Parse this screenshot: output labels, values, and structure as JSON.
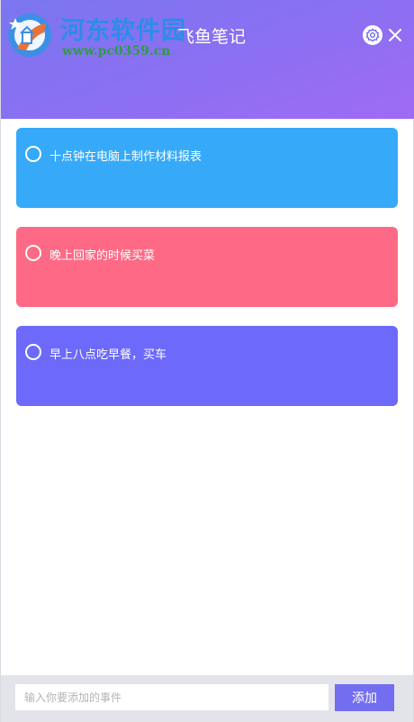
{
  "watermark": {
    "title": "河东软件园",
    "url": "www.pc0359.cn"
  },
  "header": {
    "title": "飞鱼笔记",
    "settings_icon": "gear-icon",
    "close_icon": "close-icon"
  },
  "tasks": [
    {
      "text": "十点钟在电脑上制作材料报表",
      "color": "#36aaf9"
    },
    {
      "text": "晚上回家的时候买菜",
      "color": "#fe6a85"
    },
    {
      "text": "早上八点吃早餐，买车",
      "color": "#6c69fb"
    }
  ],
  "footer": {
    "input_placeholder": "输入你要添加的事件",
    "input_value": "",
    "add_label": "添加"
  },
  "colors": {
    "header_gradient_start": "#7b76f0",
    "header_gradient_end": "#a06bf4",
    "add_button": "#736df0"
  }
}
